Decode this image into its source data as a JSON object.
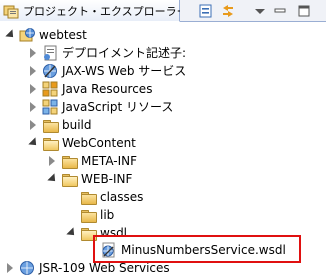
{
  "view": {
    "title": "プロジェクト・エクスプローラー",
    "close_label": "☒",
    "icon": "project-explorer-icon",
    "toolbar": [
      "collapse-all-icon",
      "link-editor-icon",
      "view-menu-icon",
      "minimize-icon",
      "maximize-icon"
    ]
  },
  "tree": {
    "items": [
      {
        "label": "webtest",
        "icon": "web-project-icon",
        "state": "expanded"
      },
      {
        "label": "デプロイメント記述子:",
        "icon": "deployment-descriptor-icon",
        "state": "collapsed"
      },
      {
        "label": "JAX-WS Web サービス",
        "icon": "jaxws-icon",
        "state": "collapsed"
      },
      {
        "label": "Java Resources",
        "icon": "java-resources-icon",
        "state": "collapsed"
      },
      {
        "label": "JavaScript リソース",
        "icon": "javascript-resources-icon",
        "state": "collapsed"
      },
      {
        "label": "build",
        "icon": "folder-icon",
        "state": "collapsed"
      },
      {
        "label": "WebContent",
        "icon": "folder-icon",
        "state": "expanded"
      },
      {
        "label": "META-INF",
        "icon": "folder-icon",
        "state": "collapsed"
      },
      {
        "label": "WEB-INF",
        "icon": "folder-icon",
        "state": "expanded"
      },
      {
        "label": "classes",
        "icon": "folder-icon",
        "state": "none"
      },
      {
        "label": "lib",
        "icon": "folder-icon",
        "state": "none"
      },
      {
        "label": "wsdl",
        "icon": "folder-icon",
        "state": "expanded"
      },
      {
        "label": "MinusNumbersService.wsdl",
        "icon": "wsdl-file-icon",
        "state": "none"
      },
      {
        "label": "JSR-109 Web Services",
        "icon": "jsr109-icon",
        "state": "collapsed"
      }
    ]
  },
  "colors": {
    "highlight_border": "#e01010",
    "tab_border": "#9aaed3"
  }
}
